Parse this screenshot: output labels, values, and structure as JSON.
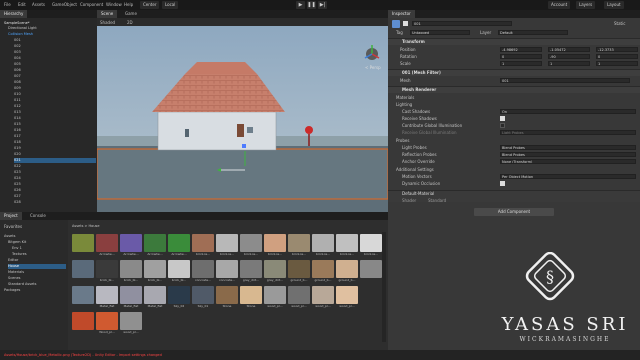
{
  "toolbar": {
    "file": "File",
    "edit": "Edit",
    "assets": "Assets",
    "gameobject": "GameObject",
    "component": "Component",
    "window": "Window",
    "help": "Help",
    "center": "Center",
    "local": "Local",
    "account": "Account",
    "layers": "Layers",
    "layout": "Layout"
  },
  "hierarchy": {
    "tab": "Hierarchy",
    "scene": "SampleScene*",
    "rows": [
      "Directional Light",
      "Collision Mesh",
      "001",
      "002",
      "003",
      "004",
      "005",
      "006",
      "007",
      "008",
      "009",
      "010",
      "011",
      "012",
      "013",
      "014",
      "015",
      "016",
      "017",
      "018",
      "019",
      "020",
      "021",
      "022",
      "023",
      "024",
      "025",
      "026",
      "027",
      "028"
    ],
    "selected_row": "021"
  },
  "scene": {
    "tab_scene": "Scene",
    "tab_game": "Game",
    "shading": "Shaded",
    "mode": "2D",
    "gizmo_label": "< Persp"
  },
  "inspector": {
    "tab": "Inspector",
    "object_name": "001",
    "static": "Static",
    "tag_label": "Tag",
    "tag_value": "Untagged",
    "layer_label": "Layer",
    "layer_value": "Default",
    "transform": "Transform",
    "position_label": "Position",
    "position": [
      "-4.98692",
      "-1.05472",
      "-12.3733"
    ],
    "rotation_label": "Rotation",
    "rotation": [
      "0",
      "-90",
      "0"
    ],
    "scale_label": "Scale",
    "scale": [
      "1",
      "1",
      "1"
    ],
    "mesh_filter": "001 (Mesh Filter)",
    "mesh_label": "Mesh",
    "mesh_value": "001",
    "mesh_renderer": "Mesh Renderer",
    "materials": "Materials",
    "lighting": "Lighting",
    "cast_shadows": "Cast Shadows",
    "cast_shadows_value": "On",
    "receive_shadows": "Receive Shadows",
    "contribute_gi": "Contribute Global Illumination",
    "receive_gi": "Receive Global Illumination",
    "receive_gi_value": "Light Probes",
    "probes": "Probes",
    "light_probes": "Light Probes",
    "light_probes_value": "Blend Probes",
    "reflection_probes": "Reflection Probes",
    "reflection_probes_value": "Blend Probes",
    "anchor_override": "Anchor Override",
    "anchor_override_value": "None (Transform)",
    "additional_settings": "Additional Settings",
    "motion_vectors": "Motion Vectors",
    "motion_vectors_value": "Per Object Motion",
    "dynamic_occlusion": "Dynamic Occlusion",
    "material_name": "Default-Material",
    "shader_label": "Shader",
    "shader_value": "Standard",
    "add_component": "Add Component"
  },
  "project": {
    "tab_project": "Project",
    "tab_console": "Console",
    "favorites": "Favorites",
    "assets": "Assets",
    "tree": [
      "Assets",
      "Bitgem Kit",
      "Env 1",
      "Textures",
      "Editor",
      "House",
      "Materials",
      "Scenes",
      "Standard Assets",
      "Packages"
    ],
    "breadcrumb": "Assets > House",
    "assets_row1": [
      "",
      "Arrowhe...",
      "Arrowhe...",
      "Arrowhe...",
      "Arrowhe...",
      "brick-la...",
      "brick-la...",
      "brick-la...",
      "brick-la...",
      "brick-la...",
      "brick-la...",
      "brick-la...",
      "brick-la..."
    ],
    "assets_row2": [
      "",
      "brick_bl...",
      "brick_bl...",
      "brick_bl...",
      "brick_bl...",
      "concrete...",
      "concrete...",
      "grey_dirt...",
      "grey_dirt...",
      "ground_b...",
      "ground_b...",
      "ground_b...",
      ""
    ],
    "assets_row3": [
      "",
      "Metal_flat",
      "Metal_flat",
      "Metal_flat",
      "Sky_02",
      "Sky_01",
      "Stone",
      "Stone",
      "wood_pl...",
      "wood_pl...",
      "wood_pl...",
      "wood_pl..."
    ],
    "assets_row4": [
      "",
      "Wood_pl...",
      "wood_pl..."
    ]
  },
  "logo": {
    "name": "YASAS SRI",
    "sub": "WICKRAMASINGHE"
  },
  "status": {
    "text": "Assets/House/brick_blue_Metallic.png (Texture2D) - Unity Editor - Import settings changed"
  },
  "colors": {
    "selection": "#2c5d87",
    "accent": "#4fa6ff",
    "error": "#ff4444"
  }
}
